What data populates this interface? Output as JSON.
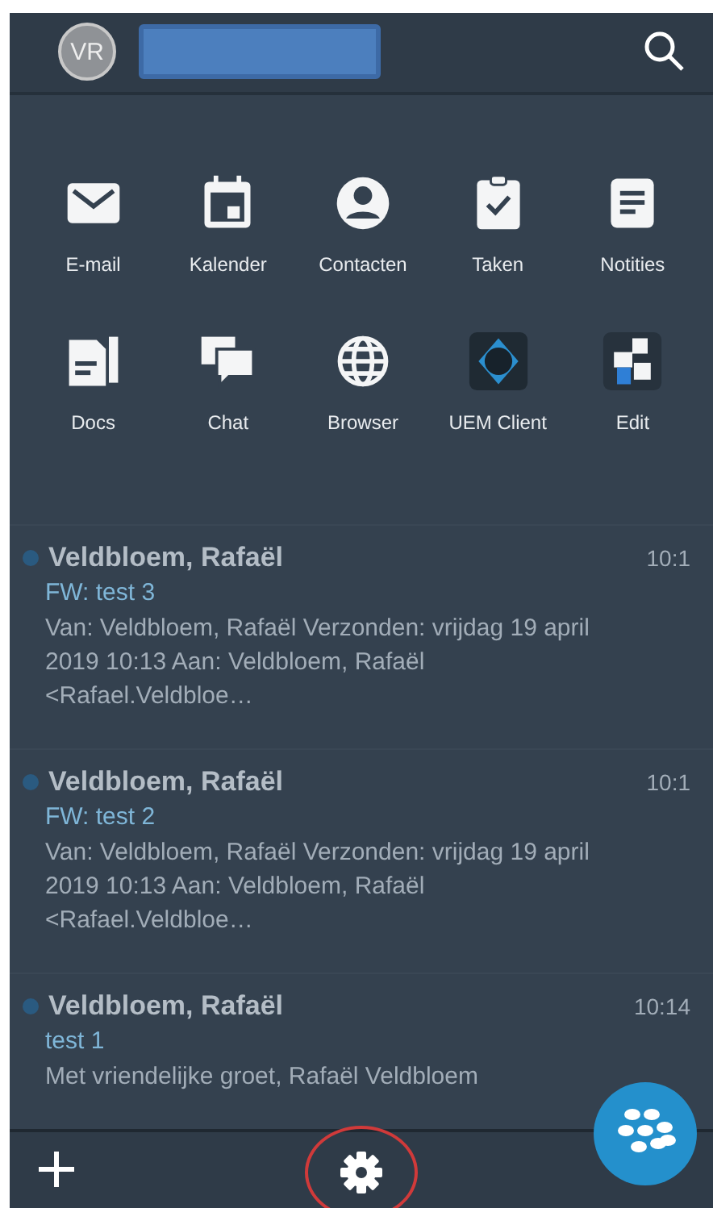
{
  "header": {
    "avatar": "VR"
  },
  "apps": [
    {
      "label": "E-mail",
      "kind": "mail"
    },
    {
      "label": "Kalender",
      "kind": "calendar"
    },
    {
      "label": "Contacten",
      "kind": "contact"
    },
    {
      "label": "Taken",
      "kind": "task"
    },
    {
      "label": "Notities",
      "kind": "note"
    },
    {
      "label": "Docs",
      "kind": "doc"
    },
    {
      "label": "Chat",
      "kind": "chat"
    },
    {
      "label": "Browser",
      "kind": "globe"
    },
    {
      "label": "UEM Client",
      "kind": "uem"
    },
    {
      "label": "Edit",
      "kind": "edit"
    }
  ],
  "messages": [
    {
      "sender": "Veldbloem, Rafaël",
      "time": "10:1",
      "subject": "FW: test 3",
      "preview": "Van: Veldbloem, Rafaël Verzonden: vrijdag 19 april 2019 10:13 Aan: Veldbloem, Rafaël <Rafael.Veldbloe…"
    },
    {
      "sender": "Veldbloem, Rafaël",
      "time": "10:1",
      "subject": "FW: test 2",
      "preview": "Van: Veldbloem, Rafaël Verzonden: vrijdag 19 april 2019 10:13 Aan: Veldbloem, Rafaël <Rafael.Veldbloe…"
    },
    {
      "sender": "Veldbloem, Rafaël",
      "time": "10:14",
      "subject": "test 1",
      "preview": "Met vriendelijke groet, Rafaël Veldbloem"
    }
  ]
}
